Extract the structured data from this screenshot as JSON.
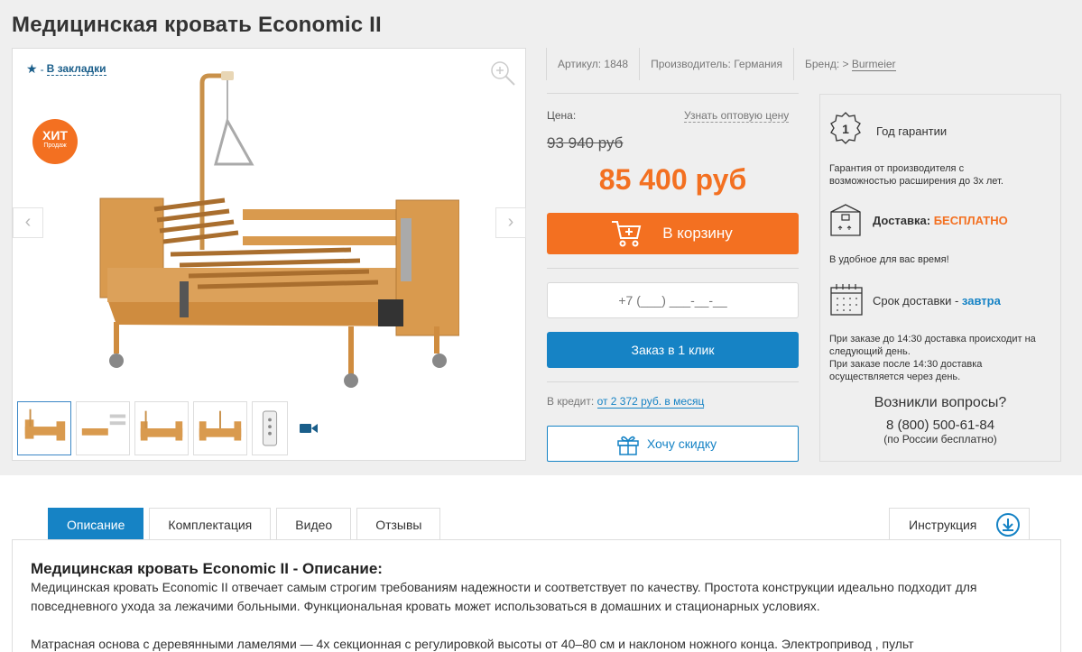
{
  "product": {
    "title": "Медицинская кровать Economic II",
    "bookmark_dash": "-",
    "bookmark_label": "В закладки",
    "badge_line1": "ХИТ",
    "badge_line2": "Продаж",
    "thumbnail_count": 5
  },
  "meta": {
    "article": "Артикул: 1848",
    "manufacturer": "Производитель: Германия",
    "brand_prefix": "Бренд: > ",
    "brand_link": "Burmeier"
  },
  "pricing": {
    "price_label": "Цена:",
    "wholesale_link": "Узнать оптовую цену",
    "old_price": "93 940 руб",
    "new_price": "85 400 руб",
    "cart_button": "В корзину",
    "phone_placeholder": "+7 (___) ___-__-__",
    "one_click_button": "Заказ в 1 клик",
    "credit_label": "В кредит:",
    "credit_link": "от 2 372 руб. в месяц",
    "discount_button": "Хочу скидку"
  },
  "delivery": {
    "warranty_number": "1",
    "warranty_title": "Год гарантии",
    "warranty_note_1": "Гарантия от производителя с",
    "warranty_note_2": "возможностью расширения до 3х лет.",
    "delivery_label": "Доставка:",
    "delivery_value": "БЕСПЛАТНО",
    "delivery_note": "В удобное для вас время!",
    "term_label": "Срок доставки - ",
    "term_value": "завтра",
    "term_note_1": "При заказе до 14:30 доставка происходит на",
    "term_note_2": "следующий день.",
    "term_note_3": "При заказе после 14:30 доставка",
    "term_note_4": "осуществляется через день.",
    "questions_title": "Возникли вопросы?",
    "phone": "8 (800) 500-61-84",
    "phone_note": "(по России бесплатно)"
  },
  "tabs": {
    "description": "Описание",
    "equipment": "Комплектация",
    "video": "Видео",
    "reviews": "Отзывы",
    "instruction": "Инструкция"
  },
  "description": {
    "heading": "Медицинская кровать Economic II - Описание:",
    "line1": "Медицинская кровать Economic II отвечает самым строгим требованиям надежности и соответствует по качеству. Простота конструкции идеально подходит для",
    "line2": "повседневного ухода за лежачими больными. Функциональная кровать может использоваться в домашних и стационарных условиях.",
    "line3": "Матрасная основа с деревянными ламелями — 4х секционная с регулировкой высоты от 40–80 см и наклоном ножного конца. Электропривод , пульт"
  },
  "colors": {
    "accent_orange": "#f37021",
    "accent_blue": "#1683c5",
    "background_gray": "#efefef"
  }
}
